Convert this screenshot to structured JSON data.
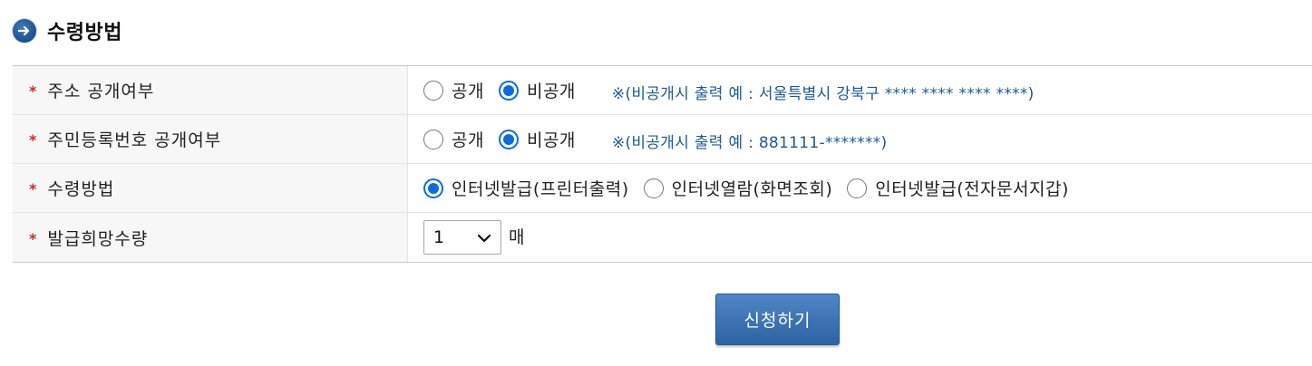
{
  "section": {
    "title": "수령방법",
    "icon": "arrow-right-circle-icon"
  },
  "rows": [
    {
      "label": "주소 공개여부",
      "required_mark": "*",
      "options": [
        {
          "label": "공개",
          "checked": false
        },
        {
          "label": "비공개",
          "checked": true
        }
      ],
      "note": "※(비공개시 출력 예 : 서울특별시 강북구 **** **** **** ****)"
    },
    {
      "label": "주민등록번호 공개여부",
      "required_mark": "*",
      "options": [
        {
          "label": "공개",
          "checked": false
        },
        {
          "label": "비공개",
          "checked": true
        }
      ],
      "note": "※(비공개시 출력 예 : 881111-*******)"
    },
    {
      "label": "수령방법",
      "required_mark": "*",
      "options": [
        {
          "label": "인터넷발급(프린터출력)",
          "checked": true
        },
        {
          "label": "인터넷열람(화면조회)",
          "checked": false
        },
        {
          "label": "인터넷발급(전자문서지갑)",
          "checked": false
        }
      ]
    },
    {
      "label": "발급희망수량",
      "required_mark": "*",
      "quantity": {
        "selected": "1",
        "unit": "매"
      }
    }
  ],
  "submit_label": "신청하기",
  "colors": {
    "accent_blue": "#0b6be0",
    "note_text": "#1d5a8e",
    "required": "#d12a2a",
    "button": "#3a73b5"
  }
}
